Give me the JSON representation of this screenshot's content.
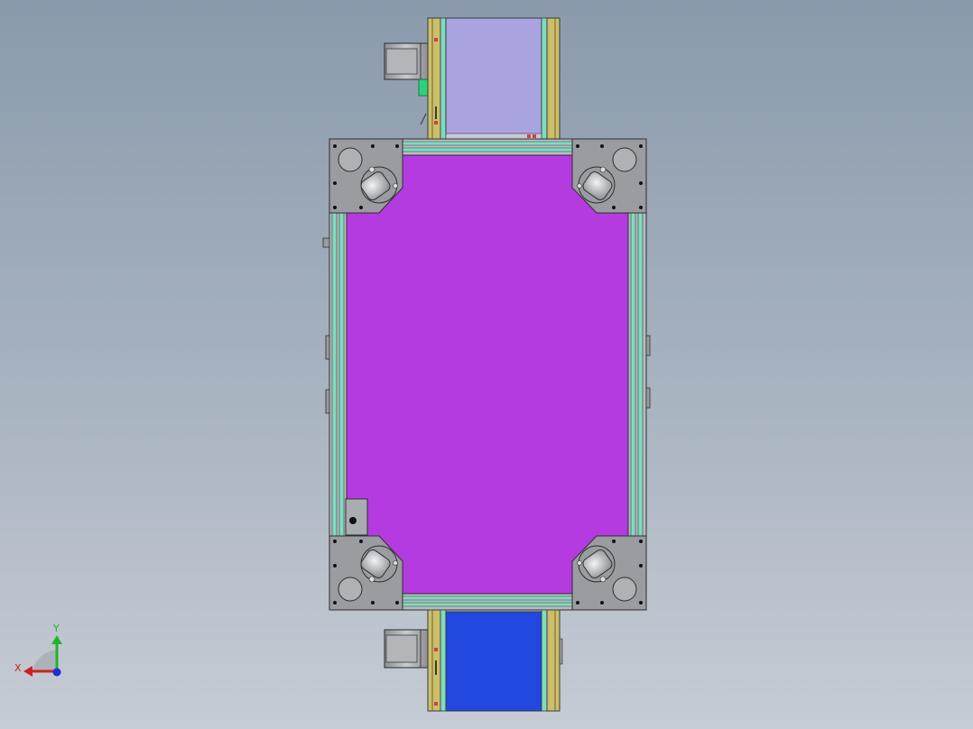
{
  "colors": {
    "background_top": "#8a9aac",
    "background_bottom": "#c6ccd5",
    "top_conveyor_belt": "#a9a3e0",
    "bottom_conveyor_belt": "#2248e0",
    "main_panel": "#b43be0",
    "frame_rail": "#7fdcc0",
    "side_plate": "#cdbf6a",
    "corner_plate": "#9a9ca2",
    "motor_body": "#a9aaad",
    "triad_x": "#d11f1f",
    "triad_y": "#1fb52a",
    "triad_z": "#1f2fd1"
  },
  "triad": {
    "x_label": "X",
    "y_label": "Y"
  }
}
